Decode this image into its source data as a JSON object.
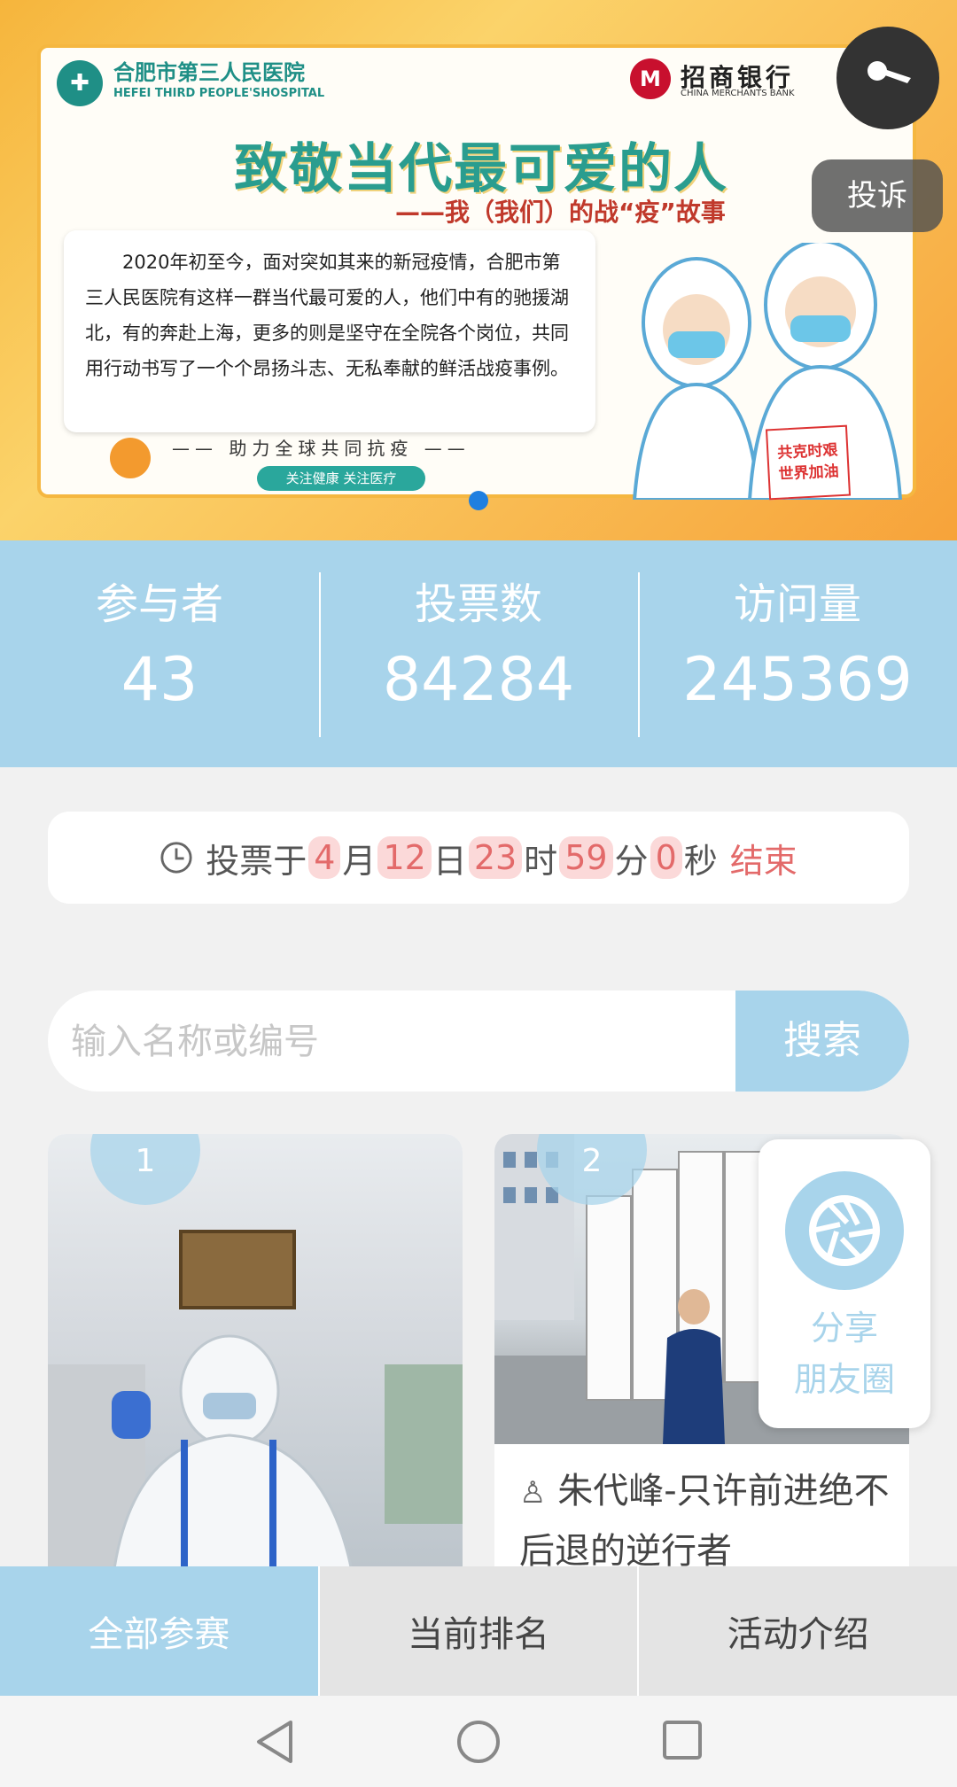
{
  "banner": {
    "hospital_name": "合肥市第三人民医院",
    "hospital_en": "HEFEI THIRD PEOPLE'SHOSPITAL",
    "bank_name": "招商银行",
    "bank_en": "CHINA MERCHANTS BANK",
    "headline": "致敬当代最可爱的人",
    "subhead": "——我（我们）的战“疫”故事",
    "intro": "2020年初至今，面对突如其来的新冠疫情，合肥市第三人民医院有这样一群当代最可爱的人，他们中有的驰援湖北，有的奔赴上海，更多的则是坚守在全院各个岗位，共同用行动书写了一个个昂扬斗志、无私奉献的鲜活战疫事例。",
    "slogan": "—— 助力全球共同抗疫 ——",
    "pill": "关注健康 关注医疗",
    "poster": "共克时艰\n世界加油"
  },
  "report_label": "投诉",
  "stats": [
    {
      "label": "参与者",
      "value": "43"
    },
    {
      "label": "投票数",
      "value": "84284"
    },
    {
      "label": "访问量",
      "value": "245369"
    }
  ],
  "countdown": {
    "prefix": "投票于",
    "month": "4",
    "month_unit": "月",
    "day": "12",
    "day_unit": "日",
    "hour": "23",
    "hour_unit": "时",
    "minute": "59",
    "minute_unit": "分",
    "second": "0",
    "second_unit": "秒",
    "suffix": "结束"
  },
  "search": {
    "placeholder": "输入名称或编号",
    "button": "搜索"
  },
  "cards": [
    {
      "rank": "1",
      "title": ""
    },
    {
      "rank": "2",
      "title": "朱代峰-只许前进绝不后退的逆行者"
    }
  ],
  "share": {
    "line1": "分享",
    "line2": "朋友圈"
  },
  "tabs": [
    "全部参赛",
    "当前排名",
    "活动介绍"
  ]
}
